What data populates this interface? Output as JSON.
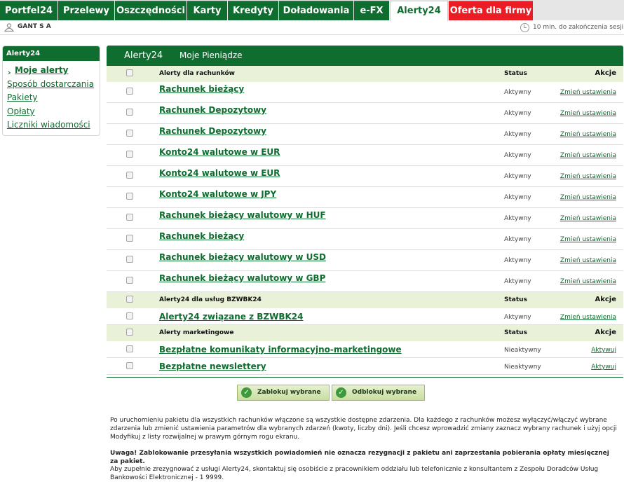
{
  "topnav": {
    "tabs": [
      {
        "label": "Portfel24"
      },
      {
        "label": "Przelewy"
      },
      {
        "label": "Oszczędności"
      },
      {
        "label": "Karty"
      },
      {
        "label": "Kredyty"
      },
      {
        "label": "Doładowania"
      },
      {
        "label": "e-FX"
      },
      {
        "label": "Alerty24"
      },
      {
        "label": "Oferta dla firmy"
      }
    ],
    "active_tab": "Alerty24"
  },
  "userbar": {
    "username": "GANT S A",
    "session": "10 min. do zakończenia sesji"
  },
  "sidebar": {
    "title": "Alerty24",
    "items": [
      {
        "label": "Moje alerty"
      },
      {
        "label": "Sposób dostarczania"
      },
      {
        "label": "Pakiety"
      },
      {
        "label": "Opłaty"
      },
      {
        "label": "Liczniki wiadomości"
      }
    ]
  },
  "main": {
    "tabs": [
      {
        "label": "Alerty24"
      },
      {
        "label": "Moje Pieniądze"
      }
    ],
    "sections": [
      {
        "title": "Alerty dla rachunków",
        "status_header": "Status",
        "action_header": "Akcje",
        "rows": [
          {
            "name": "Rachunek bieżący",
            "status": "Aktywny",
            "action": "Zmień ustawienia"
          },
          {
            "name": "Rachunek Depozytowy",
            "status": "Aktywny",
            "action": "Zmień ustawienia"
          },
          {
            "name": "Rachunek Depozytowy",
            "status": "Aktywny",
            "action": "Zmień ustawienia"
          },
          {
            "name": "Konto24 walutowe w EUR",
            "status": "Aktywny",
            "action": "Zmień ustawienia"
          },
          {
            "name": "Konto24 walutowe w EUR",
            "status": "Aktywny",
            "action": "Zmień ustawienia"
          },
          {
            "name": "Konto24 walutowe w JPY",
            "status": "Aktywny",
            "action": "Zmień ustawienia"
          },
          {
            "name": "Rachunek bieżący walutowy w HUF",
            "status": "Aktywny",
            "action": "Zmień ustawienia"
          },
          {
            "name": "Rachunek bieżący",
            "status": "Aktywny",
            "action": "Zmień ustawienia"
          },
          {
            "name": "Rachunek bieżący walutowy w USD",
            "status": "Aktywny",
            "action": "Zmień ustawienia"
          },
          {
            "name": "Rachunek bieżący walutowy w GBP",
            "status": "Aktywny",
            "action": "Zmień ustawienia"
          }
        ]
      },
      {
        "title": "Alerty24 dla usług BZWBK24",
        "status_header": "Status",
        "action_header": "Akcje",
        "rows": [
          {
            "name": "Alerty24 związane z BZWBK24",
            "status": "Aktywny",
            "action": "Zmień ustawienia"
          }
        ]
      },
      {
        "title": "Alerty marketingowe",
        "status_header": "Status",
        "action_header": "Akcje",
        "rows": [
          {
            "name": "Bezpłatne komunikaty informacyjno-marketingowe",
            "status": "Nieaktywny",
            "action": "Aktywuj"
          },
          {
            "name": "Bezpłatne newslettery",
            "status": "Nieaktywny",
            "action": "Aktywuj"
          }
        ]
      }
    ],
    "buttons": {
      "block": "Zablokuj wybrane",
      "unblock": "Odblokuj wybrane"
    },
    "info": {
      "p1": "Po uruchomieniu pakietu dla wszystkich rachunków włączone są wszystkie dostępne zdarzenia. Dla każdego z rachunków możesz wyłączyć/włączyć wybrane zdarzenia lub zmienić ustawienia parametrów dla wybranych zdarzeń (kwoty, liczby dni). Jeśli chcesz wprowadzić zmiany zaznacz wybrany rachunek i użyj opcji Modyfikuj z listy rozwijalnej w prawym górnym rogu ekranu.",
      "warning": "Uwaga! Zablokowanie przesyłania wszystkich powiadomień nie oznacza rezygnacji z pakietu ani zaprzestania pobierania opłaty miesięcznej za pakiet.",
      "p2": "Aby zupełnie zrezygnować z usługi Alerty24, skontaktuj się osobiście z pracownikiem oddziału lub telefonicznie z konsultantem z Zespołu Doradców Usług Bankowości Elektronicznej - 1 9999."
    }
  },
  "colors": {
    "brand_green": "#0f6d2f",
    "brand_red": "#ec1c24",
    "header_row_bg": "#e9f2d8"
  }
}
